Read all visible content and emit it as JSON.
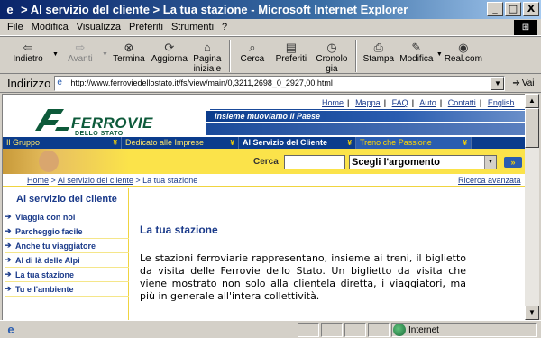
{
  "window": {
    "title": "> Al servizio del cliente > La tua stazione - Microsoft Internet Explorer",
    "buttons": {
      "minimize": "_",
      "maximize": "□",
      "close": "X"
    }
  },
  "menu": [
    "File",
    "Modifica",
    "Visualizza",
    "Preferiti",
    "Strumenti",
    "?"
  ],
  "toolbar": {
    "back": "Indietro",
    "forward": "Avanti",
    "stop": "Termina",
    "refresh": "Aggiorna",
    "home": "Pagina iniziale",
    "search": "Cerca",
    "favorites": "Preferiti",
    "history": "Cronologia",
    "print": "Stampa",
    "edit": "Modifica",
    "real": "Real.com"
  },
  "address": {
    "label": "Indirizzo",
    "url": "http://www.ferroviedellostato.it/fs/view/main/0,3211,2698_0_2927,00.html",
    "go": "Vai"
  },
  "site": {
    "top_links": [
      "Home",
      "Mappa",
      "FAQ",
      "Auto",
      "Contatti",
      "English"
    ],
    "brand": "FERROVIE",
    "brand_sub": "DELLO STATO",
    "slogan": "Insieme muoviamo il Paese",
    "sections": [
      "Il Gruppo",
      "Dedicato alle Imprese",
      "Al Servizio del Cliente",
      "Treno che Passione"
    ],
    "search_label": "Cerca",
    "search_value": "",
    "topic_select": "Scegli l'argomento",
    "go_label": "»",
    "breadcrumb": {
      "home": "Home",
      "section": "Al servizio del cliente",
      "current": "La tua stazione",
      "separator": ">"
    },
    "advanced_search": "Ricerca avanzata",
    "side_title": "Al servizio del cliente",
    "side_items": [
      "Viaggia con noi",
      "Parcheggio facile",
      "Anche tu viaggiatore",
      "Al di là delle Alpi",
      "La tua stazione",
      "Tu e l'ambiente"
    ],
    "page_title": "La tua stazione",
    "paragraph": "Le stazioni ferroviarie rappresentano, insieme ai treni, il biglietto da visita delle Ferrovie dello Stato. Un biglietto da visita che viene mostrato non solo alla clientela diretta, i viaggiatori, ma più in generale all'intera collettività."
  },
  "status": {
    "zone": "Internet"
  },
  "colors": {
    "titlebar": "#0a246a",
    "fs_blue": "#0b3c8c",
    "fs_yellow": "#fbe34a",
    "fs_green": "#0d5a3a"
  }
}
